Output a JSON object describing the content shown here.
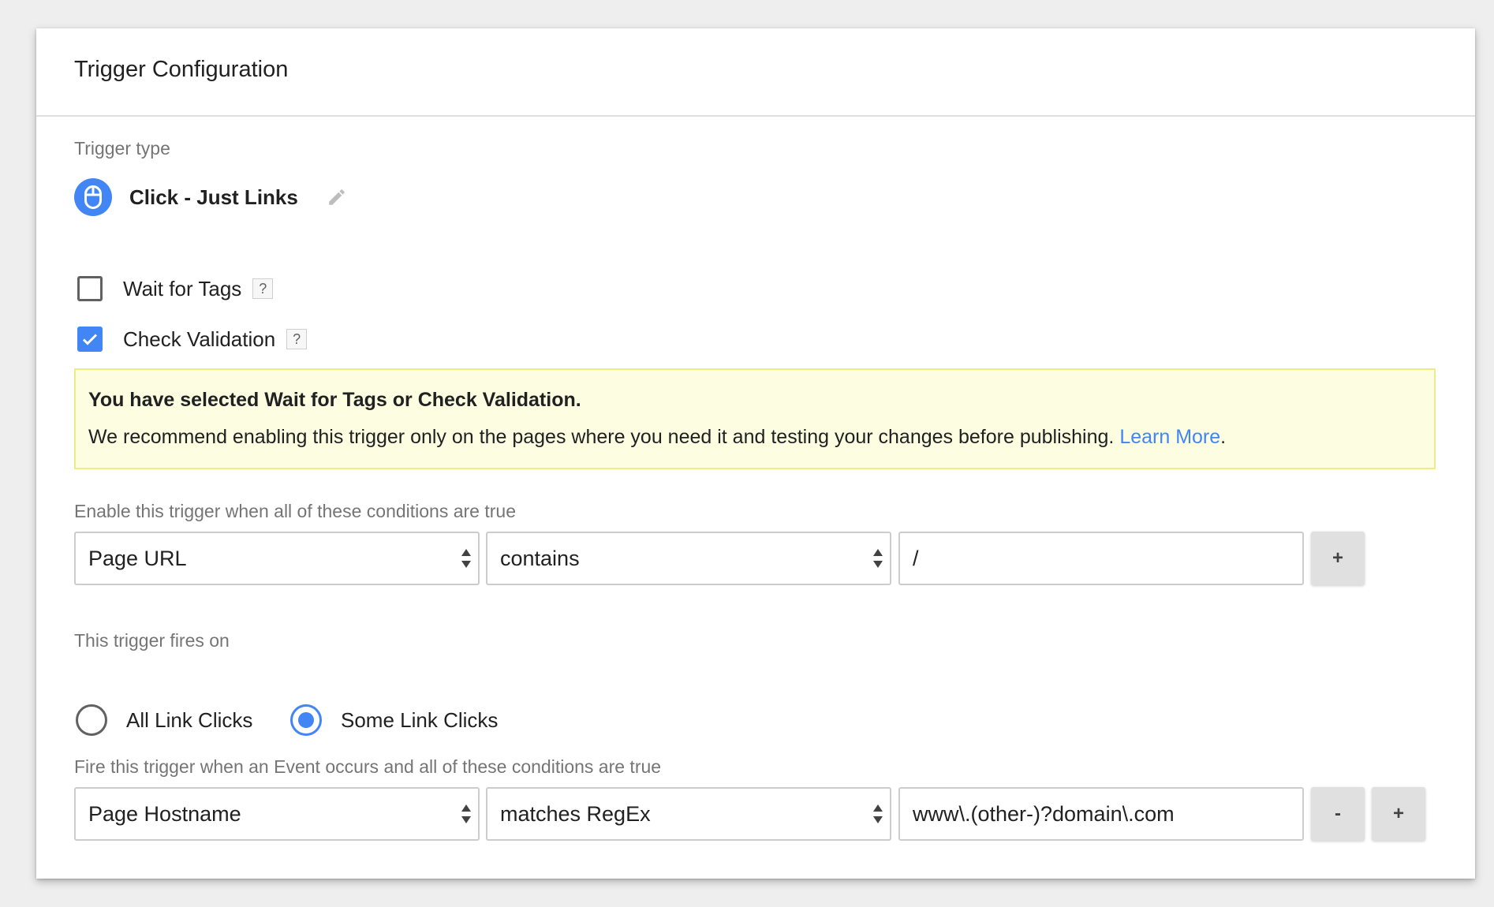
{
  "card": {
    "title": "Trigger Configuration"
  },
  "trigger_type": {
    "label": "Trigger type",
    "name": "Click - Just Links",
    "icon": "mouse-icon",
    "edit_icon": "pencil-icon"
  },
  "options": {
    "wait_for_tags": {
      "label": "Wait for Tags",
      "checked": false,
      "help": "?"
    },
    "check_validation": {
      "label": "Check Validation",
      "checked": true,
      "help": "?"
    }
  },
  "notice": {
    "title": "You have selected Wait for Tags or Check Validation.",
    "body": "We recommend enabling this trigger only on the pages where you need it and testing your changes before publishing.",
    "link": "Learn More",
    "end": "."
  },
  "enable_conditions": {
    "label": "Enable this trigger when all of these conditions are true",
    "variable": "Page URL",
    "operator": "contains",
    "value": "/",
    "add_label": "+"
  },
  "fires_on": {
    "label": "This trigger fires on",
    "options": [
      {
        "label": "All Link Clicks",
        "selected": false
      },
      {
        "label": "Some Link Clicks",
        "selected": true
      }
    ]
  },
  "fire_conditions": {
    "label": "Fire this trigger when an Event occurs and all of these conditions are true",
    "variable": "Page Hostname",
    "operator": "matches RegEx",
    "value": "www\\.(other-)?domain\\.com",
    "remove_label": "-",
    "add_label": "+"
  },
  "colors": {
    "accent": "#4285f4",
    "notice_bg": "#fdfde1",
    "notice_border": "#ecec8a"
  }
}
